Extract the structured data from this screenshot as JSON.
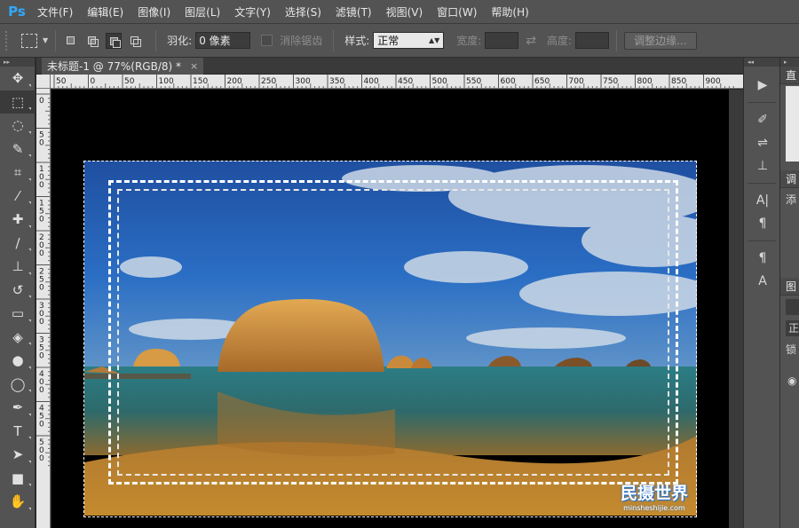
{
  "app": {
    "logo": "Ps"
  },
  "menu": [
    "文件(F)",
    "编辑(E)",
    "图像(I)",
    "图层(L)",
    "文字(Y)",
    "选择(S)",
    "滤镜(T)",
    "视图(V)",
    "窗口(W)",
    "帮助(H)"
  ],
  "options": {
    "feather_label": "羽化:",
    "feather_value": "0 像素",
    "antialias_label": "消除锯齿",
    "style_label": "样式:",
    "style_value": "正常",
    "width_label": "宽度:",
    "height_label": "高度:",
    "refine_edge": "调整边缘..."
  },
  "document": {
    "tab_title": "未标题-1 @ 77%(RGB/8) *",
    "close": "×"
  },
  "ruler": {
    "h_ticks": [
      "50",
      "0",
      "50",
      "100",
      "150",
      "200",
      "250",
      "300",
      "350",
      "400",
      "450",
      "500",
      "550",
      "600",
      "650",
      "700",
      "750",
      "800",
      "850",
      "900"
    ],
    "v_ticks": [
      "0",
      "5\n0",
      "1\n0\n0",
      "1\n5\n0",
      "2\n0\n0",
      "2\n5\n0",
      "3\n0\n0",
      "3\n5\n0",
      "4\n0\n0",
      "4\n5\n0",
      "5\n0\n0"
    ]
  },
  "watermark": {
    "title": "民摄世界",
    "url": "minsheshijie.com"
  },
  "tools": [
    {
      "name": "move-tool",
      "glyph": "✥"
    },
    {
      "name": "marquee-tool",
      "glyph": "⬚"
    },
    {
      "name": "lasso-tool",
      "glyph": "◌"
    },
    {
      "name": "quick-select-tool",
      "glyph": "✎"
    },
    {
      "name": "crop-tool",
      "glyph": "⌗"
    },
    {
      "name": "eyedropper-tool",
      "glyph": "⁄"
    },
    {
      "name": "healing-brush-tool",
      "glyph": "✚"
    },
    {
      "name": "brush-tool",
      "glyph": "∕"
    },
    {
      "name": "stamp-tool",
      "glyph": "⊥"
    },
    {
      "name": "history-brush-tool",
      "glyph": "↺"
    },
    {
      "name": "eraser-tool",
      "glyph": "▭"
    },
    {
      "name": "paint-bucket-tool",
      "glyph": "◈"
    },
    {
      "name": "blur-tool",
      "glyph": "●"
    },
    {
      "name": "dodge-tool",
      "glyph": "◯"
    },
    {
      "name": "pen-tool",
      "glyph": "✒"
    },
    {
      "name": "type-tool",
      "glyph": "T"
    },
    {
      "name": "path-select-tool",
      "glyph": "➤"
    },
    {
      "name": "shape-tool",
      "glyph": "■"
    },
    {
      "name": "hand-tool",
      "glyph": "✋"
    }
  ],
  "panels": {
    "tab1": "直",
    "tab2": "调",
    "tab3": "添",
    "tab4": "图",
    "lock": "锁",
    "normal": "正"
  }
}
